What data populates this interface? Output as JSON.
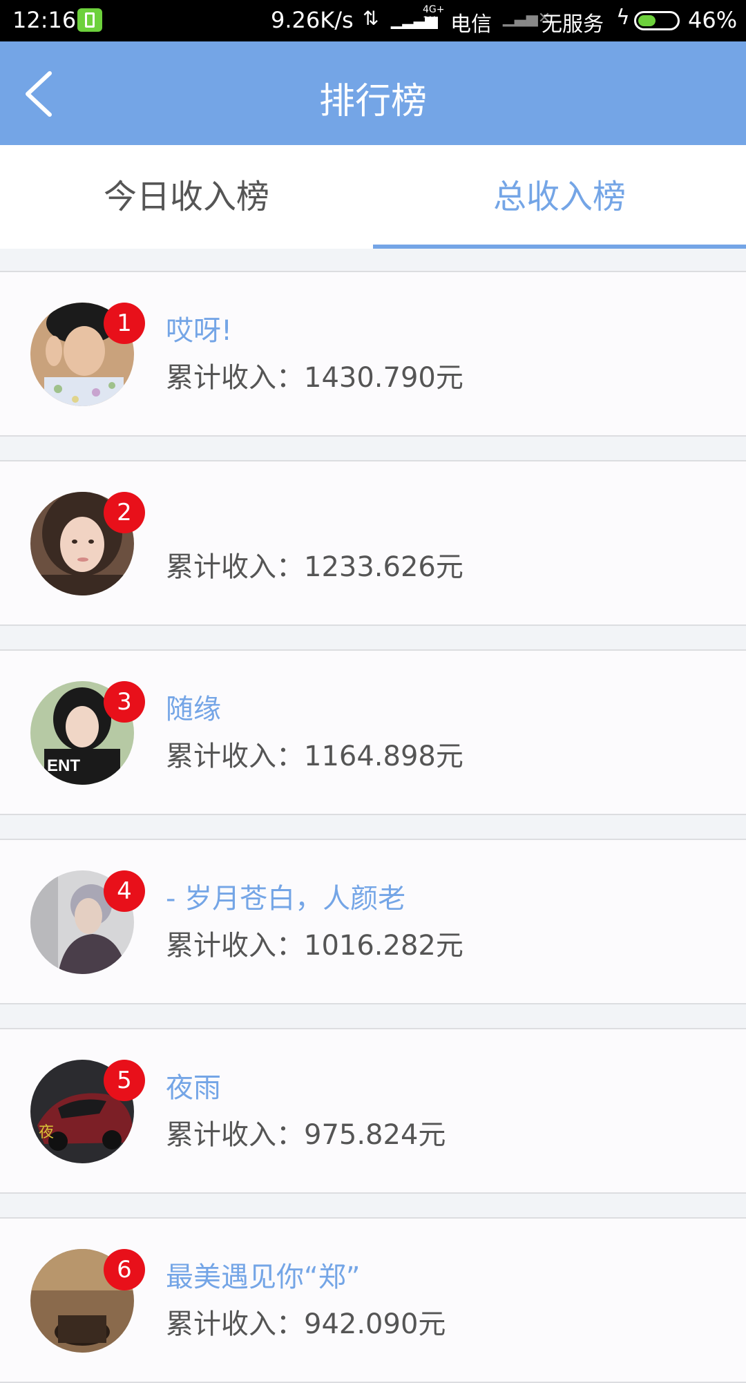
{
  "status_bar": {
    "time": "12:16",
    "speed": "9.26K/s",
    "network_top": "4G+",
    "network_bottom": "1X",
    "carrier": "电信",
    "no_service": "无服务",
    "battery_pct": "46%",
    "battery_level": 0.46
  },
  "header": {
    "title": "排行榜"
  },
  "tabs": [
    {
      "label": "今日收入榜",
      "selected": false
    },
    {
      "label": "总收入榜",
      "selected": true
    }
  ],
  "rankings": [
    {
      "rank": "1",
      "name": "哎呀!",
      "income": "累计收入：1430.790元",
      "avatar": "young-man-avatar"
    },
    {
      "rank": "2",
      "name": "",
      "income": "累计收入：1233.626元",
      "avatar": "young-woman-avatar"
    },
    {
      "rank": "3",
      "name": "随缘",
      "income": "累计收入：1164.898元",
      "avatar": "girl-avatar"
    },
    {
      "rank": "4",
      "name": "- 岁月苍白，人颜老",
      "income": "累计收入：1016.282元",
      "avatar": "man-profile-avatar"
    },
    {
      "rank": "5",
      "name": "夜雨",
      "income": "累计收入：975.824元",
      "avatar": "sports-car-avatar"
    },
    {
      "rank": "6",
      "name": "最美遇见你“郑”",
      "income": "累计收入：942.090元",
      "avatar": "coffee-avatar"
    }
  ],
  "colors": {
    "accent": "#74a5e6",
    "rank_badge": "#e8101a",
    "status_bar": "#000000"
  }
}
